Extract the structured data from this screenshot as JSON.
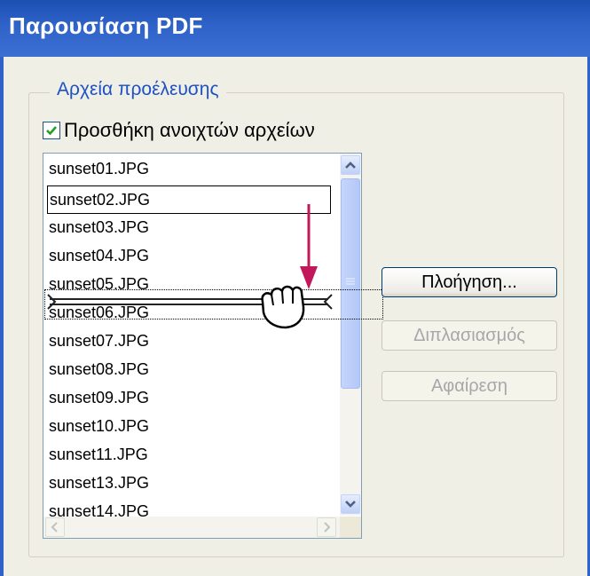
{
  "window": {
    "title": "Παρουσίαση PDF"
  },
  "source_files": {
    "group_label": "Αρχεία προέλευσης",
    "add_open_files": {
      "label": "Προσθήκη ανοιχτών αρχείων",
      "checked": true
    },
    "files": [
      "sunset01.JPG",
      "sunset02.JPG",
      "sunset03.JPG",
      "sunset04.JPG",
      "sunset05.JPG",
      "sunset06.JPG",
      "sunset07.JPG",
      "sunset08.JPG",
      "sunset09.JPG",
      "sunset10.JPG",
      "sunset11.JPG",
      "sunset13.JPG",
      "sunset14.JPG"
    ],
    "focused_file": "sunset02.JPG",
    "drag_target_file": "sunset06.JPG"
  },
  "buttons": {
    "browse": "Πλοήγηση...",
    "duplicate": "Διπλασιασμός",
    "remove": "Αφαίρεση"
  },
  "colors": {
    "titlebar": "#2f63c9",
    "legend_text": "#1e51c4",
    "arrow": "#c2185b"
  },
  "icons": {
    "drag_cursor": "hand-grab-icon",
    "drag_arrow": "arrow-down-icon"
  }
}
